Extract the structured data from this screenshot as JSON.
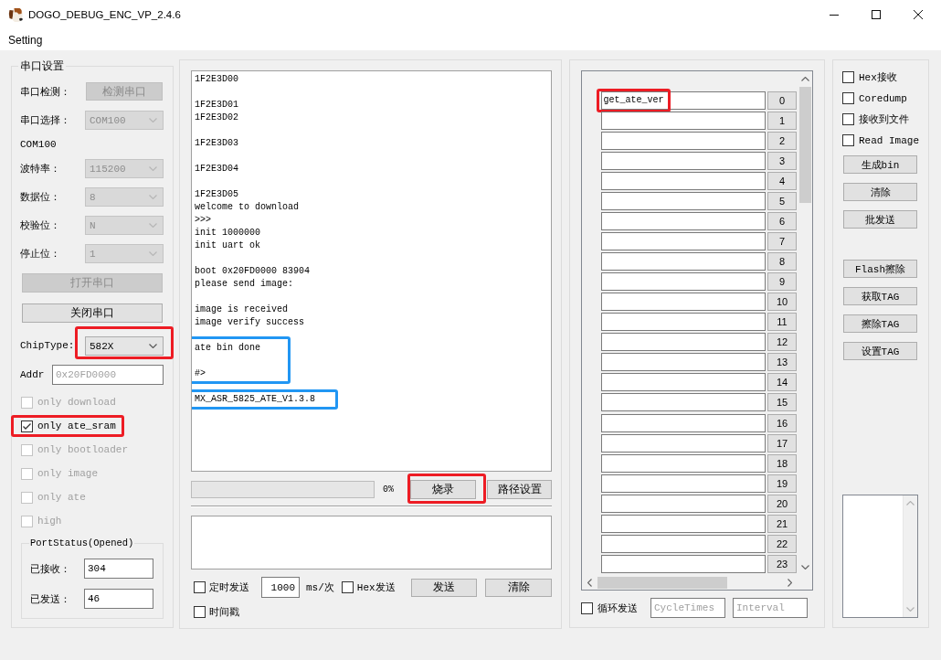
{
  "window": {
    "title": "DOGO_DEBUG_ENC_VP_2.4.6"
  },
  "menu_bar": [
    {
      "label": "Setting"
    }
  ],
  "serial_settings": {
    "title": "串口设置",
    "rows": [
      {
        "kind": "button",
        "label": "串口检测：",
        "button": "检测串口",
        "disabled": true
      },
      {
        "kind": "select",
        "label": "串口选择：",
        "value": "COM100",
        "disabled": true
      },
      {
        "kind": "text",
        "text": "COM100"
      },
      {
        "kind": "select",
        "label": "波特率：",
        "value": "115200",
        "disabled": true
      },
      {
        "kind": "select",
        "label": "数据位：",
        "value": "8",
        "disabled": true
      },
      {
        "kind": "select",
        "label": "校验位：",
        "value": "N",
        "disabled": true
      },
      {
        "kind": "select",
        "label": "停止位：",
        "value": "1",
        "disabled": true
      },
      {
        "kind": "wide_button",
        "button": "打开串口",
        "disabled": true
      },
      {
        "kind": "wide_button",
        "button": "关闭串口",
        "disabled": false
      },
      {
        "kind": "select",
        "label": "ChipType:",
        "value": "582X",
        "disabled": false,
        "highlight": {
          "color": "#ed1c24"
        }
      },
      {
        "kind": "input",
        "label": "Addr",
        "placeholder": "0x20FD0000"
      },
      {
        "kind": "checkbox",
        "label": "only download",
        "checked": false,
        "disabled": true
      },
      {
        "kind": "checkbox",
        "label": "only ate_sram",
        "checked": true,
        "disabled": false,
        "highlight": {
          "color": "#ed1c24"
        }
      },
      {
        "kind": "checkbox",
        "label": "only bootloader",
        "checked": false,
        "disabled": true
      },
      {
        "kind": "checkbox",
        "label": "only image",
        "checked": false,
        "disabled": true
      },
      {
        "kind": "checkbox",
        "label": "only ate",
        "checked": false,
        "disabled": true
      },
      {
        "kind": "checkbox",
        "label": "high",
        "checked": false,
        "disabled": true
      }
    ],
    "port_status": {
      "title": "PortStatus(Opened)",
      "fields": [
        {
          "label": "已接收：",
          "value": "304"
        },
        {
          "label": "已发送：",
          "value": "46"
        }
      ]
    }
  },
  "receive_log": {
    "blocks": [
      {
        "text": "1F2E3D00\n\n1F2E3D01\n1F2E3D02\n\n1F2E3D03\n\n1F2E3D04\n\n1F2E3D05\nwelcome to download\n>>>\ninit 1000000\ninit uart ok\n\nboot 0x20FD0000 83904\nplease send image:\n\nimage is received\nimage verify success"
      },
      {
        "text": "ate bin done\n\n#>",
        "highlight": {
          "color": "#2196f3"
        }
      },
      {
        "text": "MX_ASR_5825_ATE_V1.3.8",
        "highlight": {
          "color": "#2196f3"
        }
      }
    ]
  },
  "burn_bar": {
    "progress": {
      "level": 0,
      "reading": "0%"
    },
    "buttons": [
      {
        "label": "烧录",
        "highlight": {
          "color": "#ed1c24"
        }
      },
      {
        "label": "路径设置"
      }
    ]
  },
  "send_options": {
    "timed_send": {
      "label": "定时发送",
      "checked": false
    },
    "period": {
      "value": "1000",
      "unit": "ms/次"
    },
    "hex_send": {
      "label": "Hex发送",
      "checked": false
    },
    "buttons": [
      {
        "label": "发送"
      },
      {
        "label": "清除"
      }
    ],
    "timestamp": {
      "label": "时间戳",
      "checked": false
    }
  },
  "command_list": {
    "rows": [
      {
        "value": "get_ate_ver",
        "number": "0",
        "highlight": {
          "color": "#ed1c24"
        }
      },
      {
        "number": "1"
      },
      {
        "number": "2"
      },
      {
        "number": "3"
      },
      {
        "number": "4"
      },
      {
        "number": "5"
      },
      {
        "number": "6"
      },
      {
        "number": "7"
      },
      {
        "number": "8"
      },
      {
        "number": "9"
      },
      {
        "number": "10"
      },
      {
        "number": "11"
      },
      {
        "number": "12"
      },
      {
        "number": "13"
      },
      {
        "number": "14"
      },
      {
        "number": "15"
      },
      {
        "number": "16"
      },
      {
        "number": "17"
      },
      {
        "number": "18"
      },
      {
        "number": "19"
      },
      {
        "number": "20"
      },
      {
        "number": "21"
      },
      {
        "number": "22"
      },
      {
        "number": "23"
      }
    ],
    "loop_send": {
      "label": "循环发送",
      "checked": false
    },
    "cycle_times": {
      "placeholder": "CycleTimes"
    },
    "interval": {
      "placeholder": "Interval"
    }
  },
  "options_panel": {
    "checkboxes": [
      {
        "label": "Hex接收",
        "checked": false
      },
      {
        "label": "Coredump",
        "checked": false
      },
      {
        "label": "接收到文件",
        "checked": false
      },
      {
        "label": "Read Image",
        "checked": false
      }
    ],
    "button_groups": [
      [
        "生成bin",
        "清除",
        "批发送"
      ],
      [
        "Flash擦除",
        "获取TAG",
        "擦除TAG",
        "设置TAG"
      ]
    ]
  }
}
